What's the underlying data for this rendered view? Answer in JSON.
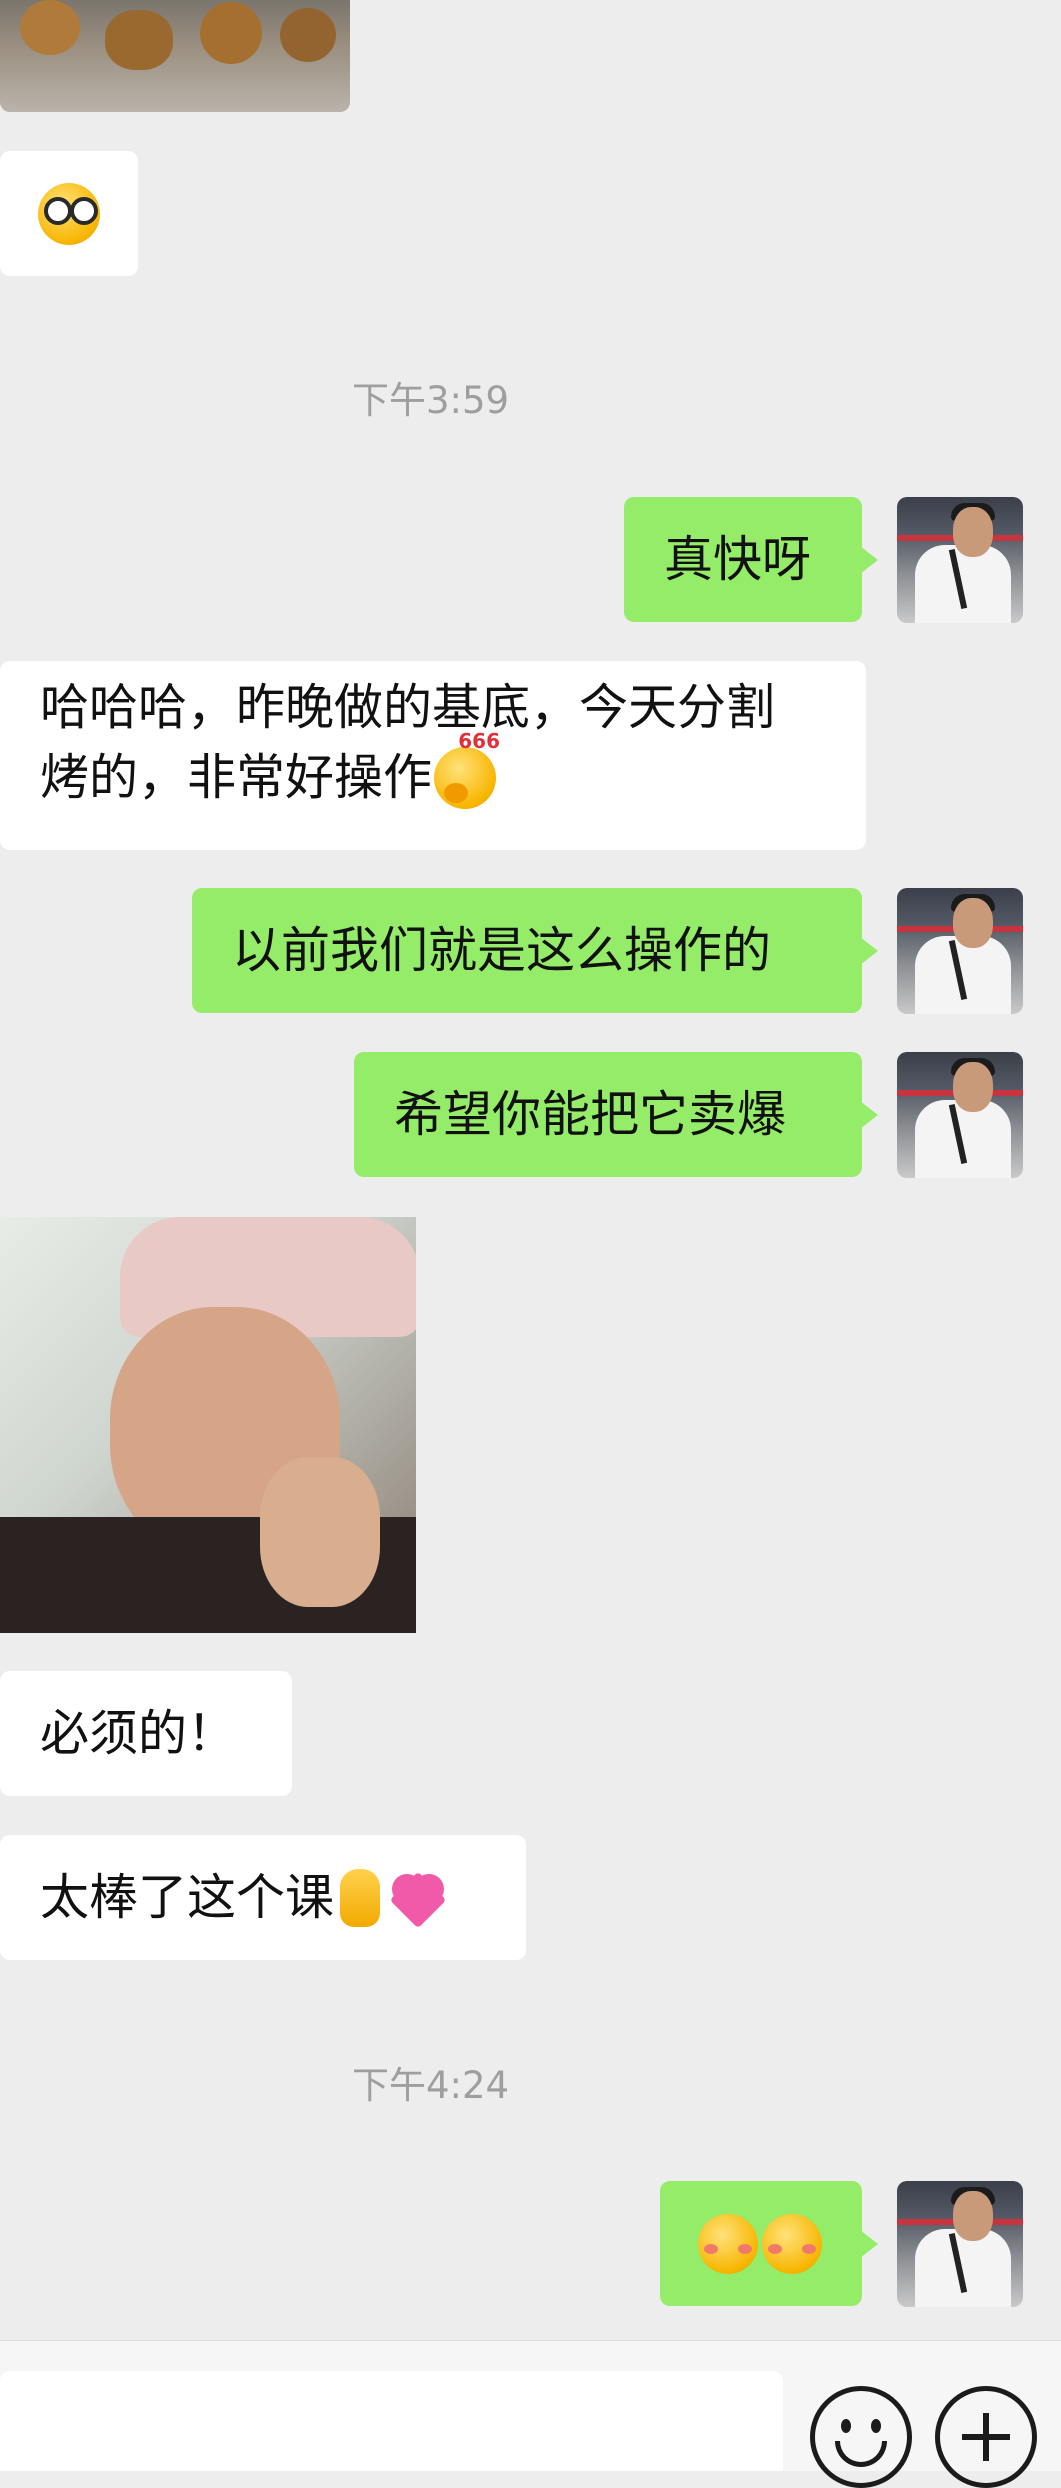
{
  "messages": {
    "m1_text": "真快呀",
    "m2_line1": "哈哈哈，昨晚做的基底，今天分割",
    "m2_line2": "烤的，非常好操作",
    "m3_text": "以前我们就是这么操作的",
    "m4_text": "希望你能把它卖爆",
    "m5_text": "必须的！",
    "m6_text": "太棒了这个课"
  },
  "timestamps": {
    "t1": "下午3:59",
    "t2": "下午4:24"
  },
  "emoji_names": {
    "smug_emoji": "thinking-666-emoji",
    "crossed_fingers": "crossed-fingers-emoji",
    "heart": "pink-heart-emoji",
    "shy": "shy-face-emoji",
    "glasses": "nerd-pointing-emoji"
  },
  "colors": {
    "outgoing_bubble": "#95ec69",
    "incoming_bubble": "#ffffff",
    "background": "#ededed"
  }
}
